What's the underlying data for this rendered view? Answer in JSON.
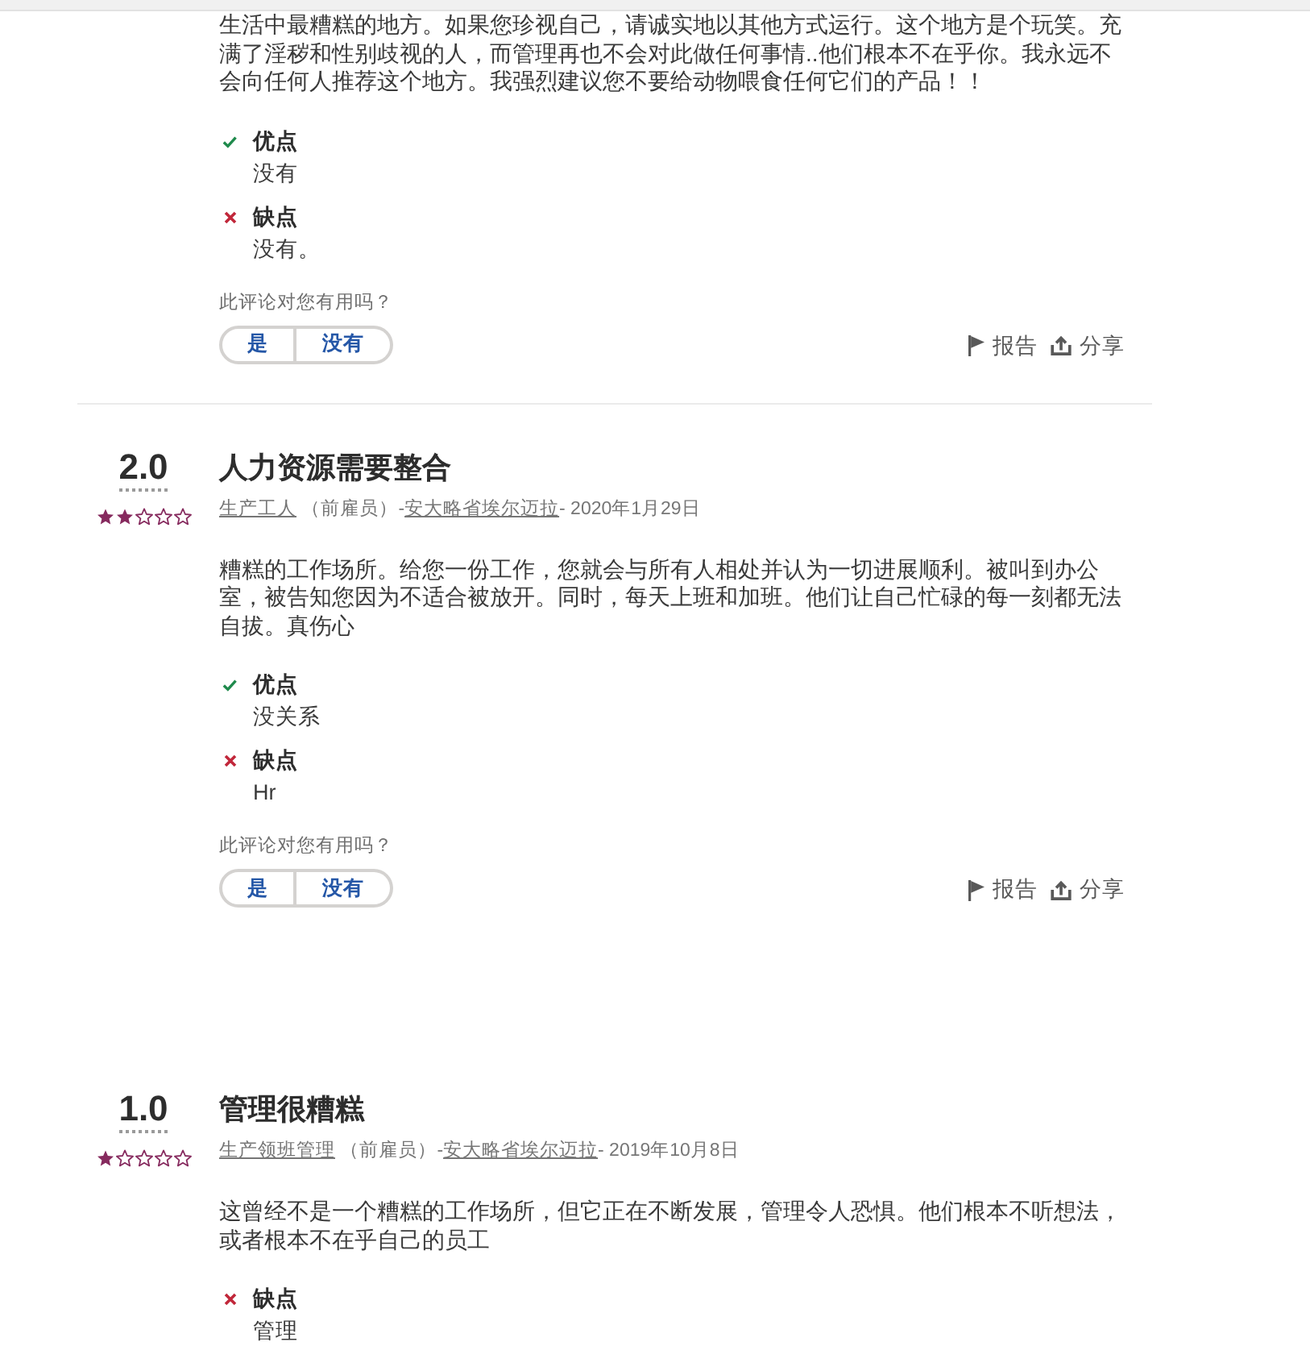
{
  "reviews": [
    {
      "body": "生活中最糟糕的地方。如果您珍视自己，请诚实地以其他方式运行。这个地方是个玩笑。充满了淫秽和性别歧视的人，而管理再也不会对此做任何事情..他们根本不在乎你。我永远不会向任何人推荐这个地方。我强烈建议您不要给动物喂食任何它们的产品！！",
      "sections": [
        {
          "kind": "pros",
          "label": "优点",
          "text": "没有"
        },
        {
          "kind": "cons",
          "label": "缺点",
          "text": "没有。"
        }
      ],
      "helpful": {
        "question": "此评论对您有用吗？",
        "votes": [
          "是",
          "没有"
        ]
      },
      "actions": [
        {
          "kind": "report",
          "label": "报告"
        },
        {
          "kind": "share",
          "label": "分享"
        }
      ]
    },
    {
      "rating": "2.0",
      "stars": 2,
      "title": "人力资源需要整合",
      "meta": [
        {
          "kind": "link",
          "text": "生产工人"
        },
        {
          "kind": "text",
          "text": " （前雇员）-"
        },
        {
          "kind": "link",
          "text": "安大略省埃尔迈拉"
        },
        {
          "kind": "text",
          "text": "- 2020年1月29日"
        }
      ],
      "body": "糟糕的工作场所。给您一份工作，您就会与所有人相处并认为一切进展顺利。被叫到办公室，被告知您因为不适合被放开。同时，每天上班和加班。他们让自己忙碌的每一刻都无法自拔。真伤心",
      "sections": [
        {
          "kind": "pros",
          "label": "优点",
          "text": "没关系"
        },
        {
          "kind": "cons",
          "label": "缺点",
          "text": "Hr"
        }
      ],
      "helpful": {
        "question": "此评论对您有用吗？",
        "votes": [
          "是",
          "没有"
        ]
      },
      "actions": [
        {
          "kind": "report",
          "label": "报告"
        },
        {
          "kind": "share",
          "label": "分享"
        }
      ]
    },
    {
      "rating": "1.0",
      "stars": 1,
      "title": "管理很糟糕",
      "meta": [
        {
          "kind": "link",
          "text": "生产领班管理"
        },
        {
          "kind": "text",
          "text": " （前雇员）-"
        },
        {
          "kind": "link",
          "text": "安大略省埃尔迈拉"
        },
        {
          "kind": "text",
          "text": "- 2019年10月8日"
        }
      ],
      "body": "这曾经不是一个糟糕的工作场所，但它正在不断发展，管理令人恐惧。他们根本不听想法，或者根本不在乎自己的员工",
      "sections": [
        {
          "kind": "cons",
          "label": "缺点",
          "text": "管理"
        }
      ]
    }
  ]
}
